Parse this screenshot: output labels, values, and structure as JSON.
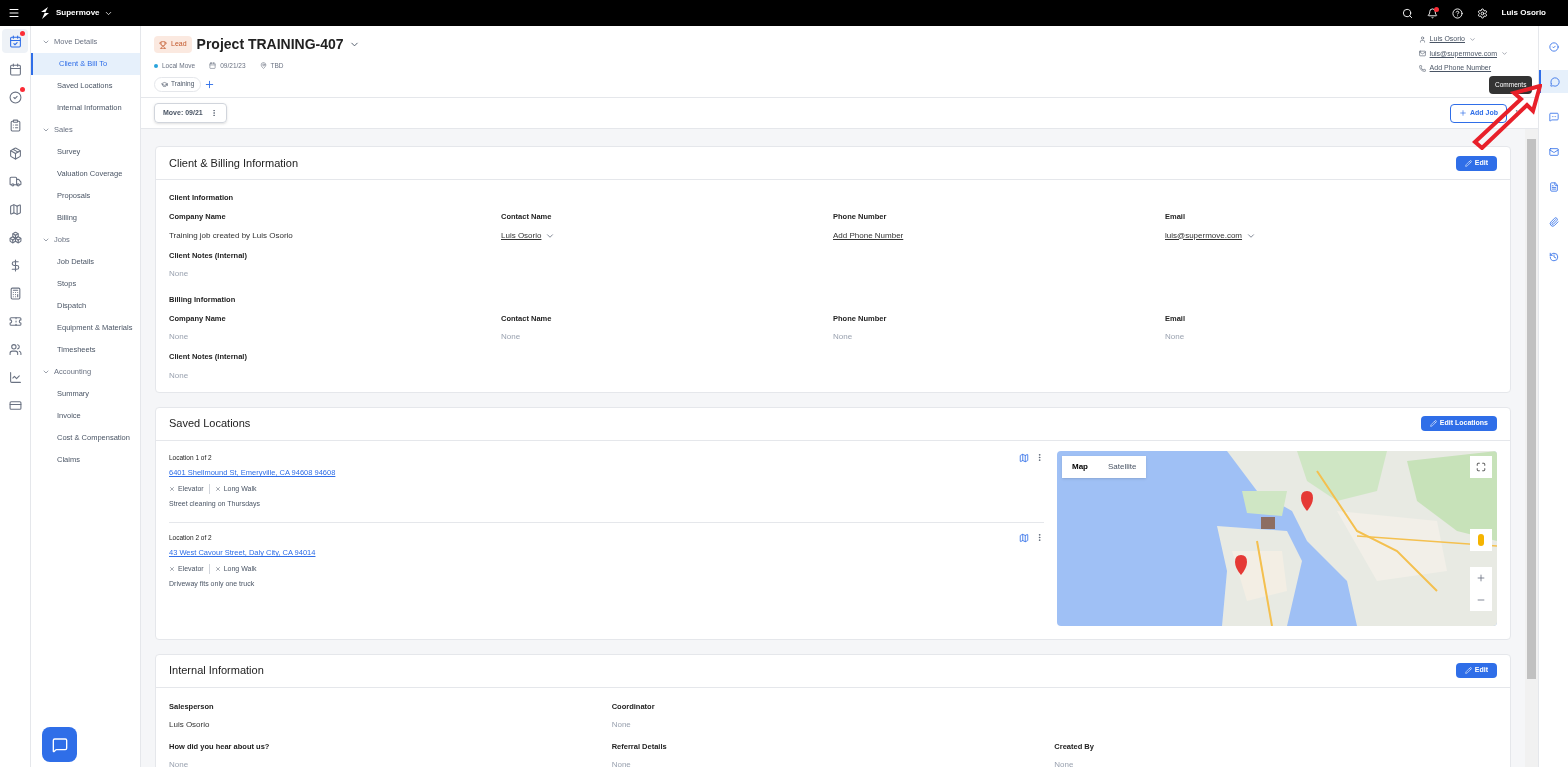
{
  "top_bar": {
    "brand": "Supermove",
    "user": "Luis Osorio",
    "has_notifications": true
  },
  "icon_rail": [
    {
      "kind": "calendar-check",
      "selected": true,
      "badge": true
    },
    {
      "kind": "calendar",
      "selected": false,
      "badge": false
    },
    {
      "kind": "check-circle",
      "selected": false,
      "badge": true
    },
    {
      "kind": "clipboard",
      "selected": false,
      "badge": false
    },
    {
      "kind": "package",
      "selected": false,
      "badge": false
    },
    {
      "kind": "truck",
      "selected": false,
      "badge": false
    },
    {
      "kind": "map",
      "selected": false,
      "badge": false
    },
    {
      "kind": "boxes",
      "selected": false,
      "badge": false
    },
    {
      "kind": "dollar",
      "selected": false,
      "badge": false
    },
    {
      "kind": "calculator",
      "selected": false,
      "badge": false
    },
    {
      "kind": "ticket",
      "selected": false,
      "badge": false
    },
    {
      "kind": "users",
      "selected": false,
      "badge": false
    },
    {
      "kind": "chart",
      "selected": false,
      "badge": false
    },
    {
      "kind": "card",
      "selected": false,
      "badge": false
    }
  ],
  "nav": [
    {
      "label": "Move Details",
      "expanded": true,
      "children": [
        {
          "label": "Client & Bill To",
          "selected": true
        },
        {
          "label": "Saved Locations",
          "selected": false
        },
        {
          "label": "Internal Information",
          "selected": false
        }
      ]
    },
    {
      "label": "Sales",
      "expanded": true,
      "children": [
        {
          "label": "Survey",
          "selected": false
        },
        {
          "label": "Valuation Coverage",
          "selected": false
        },
        {
          "label": "Proposals",
          "selected": false
        },
        {
          "label": "Billing",
          "selected": false
        }
      ]
    },
    {
      "label": "Jobs",
      "expanded": true,
      "children": [
        {
          "label": "Job Details",
          "selected": false
        },
        {
          "label": "Stops",
          "selected": false
        },
        {
          "label": "Dispatch",
          "selected": false
        },
        {
          "label": "Equipment & Materials",
          "selected": false
        },
        {
          "label": "Timesheets",
          "selected": false
        }
      ]
    },
    {
      "label": "Accounting",
      "expanded": true,
      "children": [
        {
          "label": "Summary",
          "selected": false
        },
        {
          "label": "Invoice",
          "selected": false
        },
        {
          "label": "Cost & Compensation",
          "selected": false
        },
        {
          "label": "Claims",
          "selected": false
        }
      ]
    }
  ],
  "project": {
    "status": "Lead",
    "title": "Project TRAINING-407",
    "move_type": "Local Move",
    "date": "09/21/23",
    "location": "TBD",
    "tags": [
      "Training"
    ]
  },
  "contact": {
    "name": "Luis Osorio",
    "email": "luis@supermove.com",
    "phone": "Add Phone Number"
  },
  "job_bar": {
    "move_tab": "Move: 09/21",
    "add_job": "Add Job"
  },
  "client_billing": {
    "title": "Client & Billing Information",
    "edit": "Edit",
    "sections": [
      {
        "heading": "Client Information",
        "fields": [
          {
            "label": "Company Name",
            "value": "Training job created by Luis Osorio",
            "kind": "text"
          },
          {
            "label": "Contact Name",
            "value": "Luis Osorio",
            "kind": "link-menu"
          },
          {
            "label": "Phone Number",
            "value": "Add Phone Number",
            "kind": "link"
          },
          {
            "label": "Email",
            "value": "luis@supermove.com",
            "kind": "link-menu"
          }
        ],
        "notes": {
          "label": "Client Notes (Internal)",
          "value": "None"
        }
      },
      {
        "heading": "Billing Information",
        "fields": [
          {
            "label": "Company Name",
            "value": "None",
            "kind": "empty"
          },
          {
            "label": "Contact Name",
            "value": "None",
            "kind": "empty"
          },
          {
            "label": "Phone Number",
            "value": "None",
            "kind": "empty"
          },
          {
            "label": "Email",
            "value": "None",
            "kind": "empty"
          }
        ],
        "notes": {
          "label": "Client Notes (Internal)",
          "value": "None"
        }
      }
    ]
  },
  "saved_locations": {
    "title": "Saved Locations",
    "edit": "Edit Locations",
    "locations": [
      {
        "heading": "Location 1 of 2",
        "address": "6401 Shellmound St, Emeryville, CA 94608 94608",
        "features": [
          "Elevator",
          "Long Walk"
        ],
        "note": "Street cleaning on Thursdays"
      },
      {
        "heading": "Location 2 of 2",
        "address": "43 West Cavour Street, Daly City, CA 94014",
        "features": [
          "Elevator",
          "Long Walk"
        ],
        "note": "Driveway fits only one truck"
      }
    ],
    "map": {
      "kind": "picture",
      "tabs": [
        {
          "label": "Map",
          "selected": true
        },
        {
          "label": "Satellite",
          "selected": false
        }
      ]
    }
  },
  "internal": {
    "title": "Internal Information",
    "edit": "Edit",
    "rows": [
      [
        {
          "label": "Salesperson",
          "value": "Luis Osorio",
          "kind": "text"
        },
        {
          "label": "Coordinator",
          "value": "None",
          "kind": "empty"
        }
      ],
      [
        {
          "label": "How did you hear about us?",
          "value": "None",
          "kind": "empty"
        },
        {
          "label": "Referral Details",
          "value": "None",
          "kind": "empty"
        },
        {
          "label": "Created By",
          "value": "None",
          "kind": "empty"
        }
      ]
    ]
  },
  "right_rail": {
    "tooltip": "Comments",
    "items": [
      {
        "kind": "check",
        "selected": false
      },
      {
        "kind": "comment",
        "selected": true
      },
      {
        "kind": "chat",
        "selected": false
      },
      {
        "kind": "mail",
        "selected": false
      },
      {
        "kind": "file",
        "selected": false
      },
      {
        "kind": "paperclip",
        "selected": false
      },
      {
        "kind": "history",
        "selected": false
      }
    ]
  }
}
